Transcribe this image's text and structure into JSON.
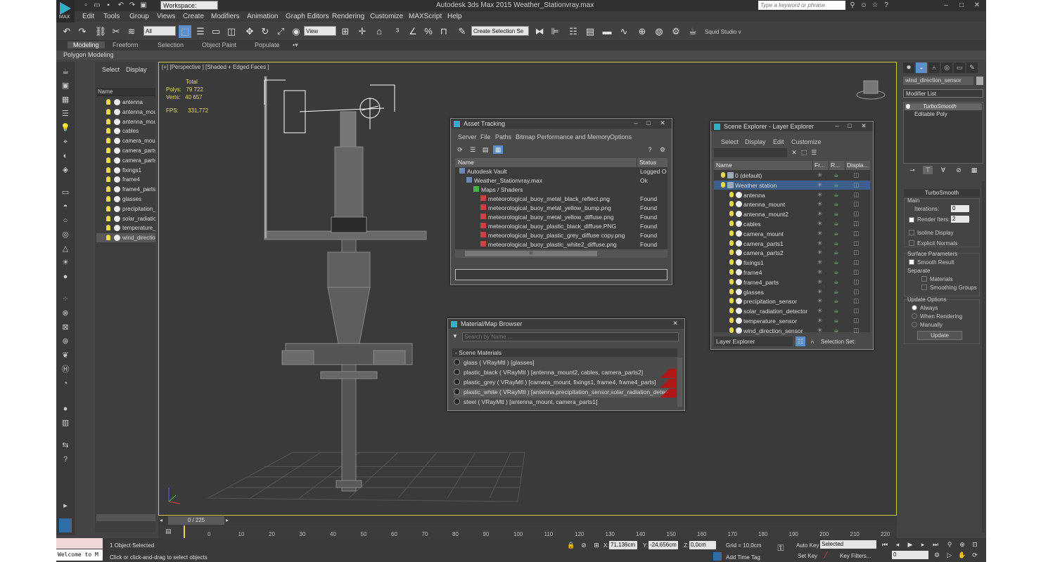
{
  "title_bar": {
    "logo_label": "MAX",
    "workspace": "Workspace: Default",
    "app_title": "Autodesk 3ds Max  2015      Weather_Stationvray.max",
    "search_placeholder": "Type a keyword or phrase"
  },
  "menu": [
    "Edit",
    "Tools",
    "Group",
    "Views",
    "Create",
    "Modifiers",
    "Animation",
    "Graph Editors",
    "Rendering",
    "Customize",
    "MAXScript",
    "Help"
  ],
  "toolbar": {
    "selection_filter": "All",
    "ref_coord": "View",
    "named_selection": "Create Selection Se",
    "studio_label": "Squid Studio v"
  },
  "ribbon": {
    "tabs": [
      "Modeling",
      "Freeform",
      "Selection",
      "Object Paint",
      "Populate"
    ],
    "sub_label": "Polygon Modeling"
  },
  "side_explorer": {
    "tabs": [
      "Select",
      "Display"
    ],
    "col_name": "Name",
    "items": [
      "antenna",
      "antenna_mou",
      "antenna_mou",
      "cables",
      "camera_moun",
      "camera_parts",
      "camera_parts",
      "fixings1",
      "frame4",
      "frame4_parts",
      "glasses",
      "precipitation_",
      "solar_radiatio",
      "temperature_",
      "wind_directio"
    ]
  },
  "viewport": {
    "label": "[+] [Perspective ] [Shaded + Edged Faces ]",
    "stats": {
      "total_label": "Total",
      "polys_label": "Polys:",
      "polys": "79 722",
      "verts_label": "Verts:",
      "verts": "40 657",
      "fps_label": "FPS:",
      "fps": "331,772"
    }
  },
  "asset_tracking": {
    "title": "Asset Tracking",
    "menu": [
      "Server",
      "File",
      "Paths",
      "Bitmap Performance and Memory",
      "Options"
    ],
    "col_name": "Name",
    "col_status": "Status",
    "rows": [
      {
        "name": "Autodesk Vault",
        "status": "Logged Ou",
        "indent": 0
      },
      {
        "name": "Weather_Stationvray.max",
        "status": "Ok",
        "indent": 1
      },
      {
        "name": "Maps / Shaders",
        "status": "",
        "indent": 2
      },
      {
        "name": "meteorological_buoy_metal_black_reflect.png",
        "status": "Found",
        "indent": 3
      },
      {
        "name": "meteorological_buoy_metal_yellow_bump.png",
        "status": "Found",
        "indent": 3
      },
      {
        "name": "meteorological_buoy_metal_yellow_diffuse.png",
        "status": "Found",
        "indent": 3
      },
      {
        "name": "meteorological_buoy_plastic_black_diffuse.PNG",
        "status": "Found",
        "indent": 3
      },
      {
        "name": "meteorological_buoy_plastic_grey_diffuse copy.png",
        "status": "Found",
        "indent": 3
      },
      {
        "name": "meteorological_buoy_plastic_white2_diffuse.png",
        "status": "Found",
        "indent": 3
      }
    ],
    "scroll_grip": "III"
  },
  "material_browser": {
    "title": "Material/Map Browser",
    "search_placeholder": "Search by Name ...",
    "section": "- Scene Materials",
    "materials": [
      "glass  ( VRayMtl ) [glasses]",
      "plastic_black  ( VRayMtl ) [antenna_mount2, cables, camera_parts2]",
      "plastic_grey  ( VRayMtl ) [camera_mount, fixings1, frame4, frame4_parts]",
      "plastic_white  ( VRayMtl ) [antenna,precipitation_sensor,solar_radiation_detecto...",
      "steel  ( VRayMtl ) [antenna_mount, camera_parts1]"
    ]
  },
  "layer_explorer": {
    "title": "Scene Explorer - Layer Explorer",
    "menu": [
      "Select",
      "Display",
      "Edit",
      "Customize"
    ],
    "cols": [
      "Name",
      "Fr...",
      "R...",
      "Displa..."
    ],
    "layers": [
      "0 (default)",
      "Weather station"
    ],
    "objects": [
      "antenna",
      "antenna_mount",
      "antenna_mount2",
      "cables",
      "camera_mount",
      "camera_parts1",
      "camera_parts2",
      "fixings1",
      "frame4",
      "frame4_parts",
      "glasses",
      "precipitation_sensor",
      "solar_radiation_detector",
      "temperature_sensor",
      "wind_direction_sensor"
    ],
    "footer_mode": "Layer Explorer",
    "footer_selset": "Selection Set:"
  },
  "command_panel": {
    "object_name": "wind_direction_sensor",
    "modifier_list": "Modifier List",
    "stack": [
      "TurboSmooth",
      "Editable Poly"
    ],
    "rollout": "TurboSmooth",
    "main_label": "Main",
    "iterations_label": "Iterations:",
    "iterations": "0",
    "render_iters_label": "Render Iters:",
    "render_iters": "2",
    "isoline": "Isoline Display",
    "explicit": "Explicit Normals",
    "surface_label": "Surface Parameters",
    "smooth_result": "Smooth Result",
    "separate": "Separate",
    "materials": "Materials",
    "smoothing_groups": "Smoothing Groups",
    "update_label": "Update Options",
    "always": "Always",
    "when_rendering": "When Rendering",
    "manually": "Manually",
    "update_btn": "Update"
  },
  "timeline": {
    "frame": "0 / 225",
    "ticks": [
      "0",
      "10",
      "20",
      "30",
      "40",
      "50",
      "60",
      "70",
      "80",
      "90",
      "100",
      "110",
      "120",
      "130",
      "140",
      "150",
      "160",
      "170",
      "180",
      "190",
      "200",
      "210",
      "220"
    ]
  },
  "status_bar": {
    "maxscript": "Welcome to M",
    "selected": "1 Object Selected",
    "prompt": "Click or click-and-drag to select objects",
    "x_label": "X:",
    "x": "71,136cm",
    "y_label": "Y:",
    "y": "-24,656cm",
    "z_label": "Z:",
    "z": "0,0cm",
    "grid": "Grid = 10,0cm",
    "auto_key": "Auto Key",
    "key_mode": "Selected",
    "set_key": "Set Key",
    "key_filters": "Key Filters...",
    "add_time_tag": "Add Time Tag",
    "frame_field": "0"
  }
}
